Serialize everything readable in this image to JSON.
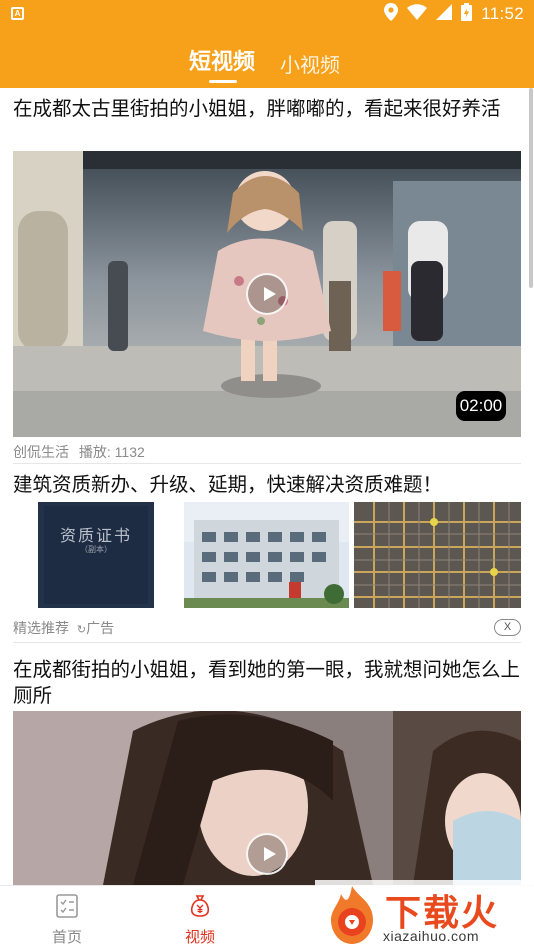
{
  "status_bar": {
    "time": "11:52",
    "left_badge": "A"
  },
  "top_tabs": [
    {
      "label": "短视频",
      "active": true
    },
    {
      "label": "小视频",
      "active": false
    }
  ],
  "feed": [
    {
      "title": "在成都太古里街拍的小姐姐，胖嘟嘟的，看起来很好养活",
      "duration": "02:00",
      "source": "创侃生活",
      "plays": "播放: 1132"
    },
    {
      "title": "建筑资质新办、升级、延期，快速解决资质难题！",
      "thumb1_line1": "资质证书",
      "thumb1_line2": "（副本）",
      "source": "精选推荐",
      "ad_label": "广告",
      "close_label": "X"
    },
    {
      "title": "在成都街拍的小姐姐，看到她的第一眼，我就想问她怎么上厕所"
    }
  ],
  "bottom_nav": [
    {
      "label": "首页",
      "icon": "document-icon",
      "active": false
    },
    {
      "label": "视频",
      "icon": "money-bag-icon",
      "active": true
    }
  ],
  "watermark": {
    "text": "下载火",
    "url": "xiazaihuo.com"
  },
  "colors": {
    "brand": "#f7a01a",
    "active_nav": "#e0321e",
    "muted": "#8a8a8a"
  }
}
